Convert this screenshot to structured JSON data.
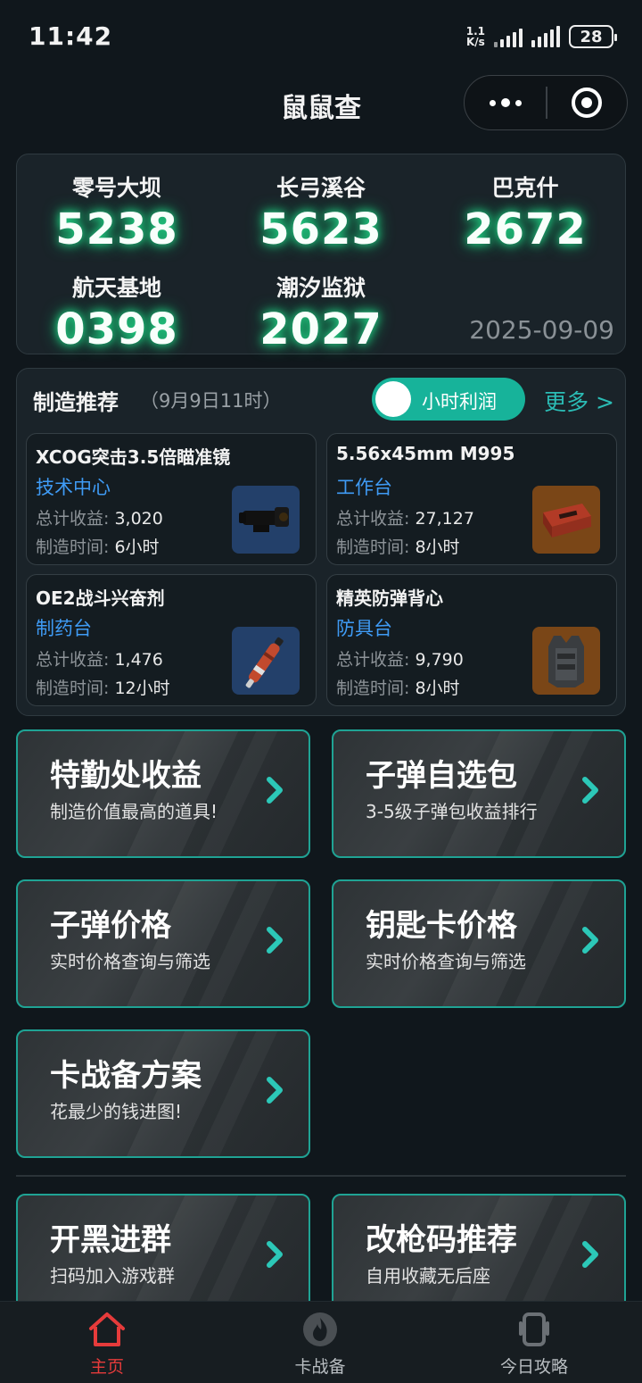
{
  "status_bar": {
    "time": "11:42",
    "net_speed_value": "1.1",
    "net_speed_unit": "K/s",
    "battery": "28"
  },
  "header": {
    "title": "鼠鼠查"
  },
  "codes": {
    "items": [
      {
        "name": "零号大坝",
        "code": "5238"
      },
      {
        "name": "长弓溪谷",
        "code": "5623"
      },
      {
        "name": "巴克什",
        "code": "2672"
      },
      {
        "name": "航天基地",
        "code": "0398"
      },
      {
        "name": "潮汐监狱",
        "code": "2027"
      }
    ],
    "date": "2025-09-09"
  },
  "craft": {
    "title": "制造推荐",
    "time": "（9月9日11时）",
    "toggle_label": "小时利润",
    "more_label": "更多 >",
    "income_label": "总计收益:",
    "time_label": "制造时间:",
    "items": [
      {
        "name": "XCOG突击3.5倍瞄准镜",
        "station": "技术中心",
        "income": "3,020",
        "duration": "6小时",
        "icon": "scope-icon"
      },
      {
        "name": "5.56x45mm M995",
        "station": "工作台",
        "income": "27,127",
        "duration": "8小时",
        "icon": "ammo-box-icon"
      },
      {
        "name": "OE2战斗兴奋剂",
        "station": "制药台",
        "income": "1,476",
        "duration": "12小时",
        "icon": "stim-injector-icon"
      },
      {
        "name": "精英防弹背心",
        "station": "防具台",
        "income": "9,790",
        "duration": "8小时",
        "icon": "armor-vest-icon"
      }
    ]
  },
  "features": [
    {
      "title": "特勤处收益",
      "subtitle": "制造价值最高的道具!"
    },
    {
      "title": "子弹自选包",
      "subtitle": "3-5级子弹包收益排行"
    },
    {
      "title": "子弹价格",
      "subtitle": "实时价格查询与筛选"
    },
    {
      "title": "钥匙卡价格",
      "subtitle": "实时价格查询与筛选"
    },
    {
      "title": "卡战备方案",
      "subtitle": "花最少的钱进图!"
    },
    {
      "title": "开黑进群",
      "subtitle": "扫码加入游戏群"
    },
    {
      "title": "改枪码推荐",
      "subtitle": "自用收藏无后座"
    }
  ],
  "tabbar": {
    "tabs": [
      {
        "label": "主页",
        "icon": "home-icon",
        "active": true
      },
      {
        "label": "卡战备",
        "icon": "flame-icon",
        "active": false
      },
      {
        "label": "今日攻略",
        "icon": "phone-icon",
        "active": false
      }
    ]
  },
  "colors": {
    "accent_teal": "#17b39a",
    "code_glow": "#23d98a",
    "station_blue": "#3f9bf5",
    "tab_active_red": "#e63b3b"
  }
}
